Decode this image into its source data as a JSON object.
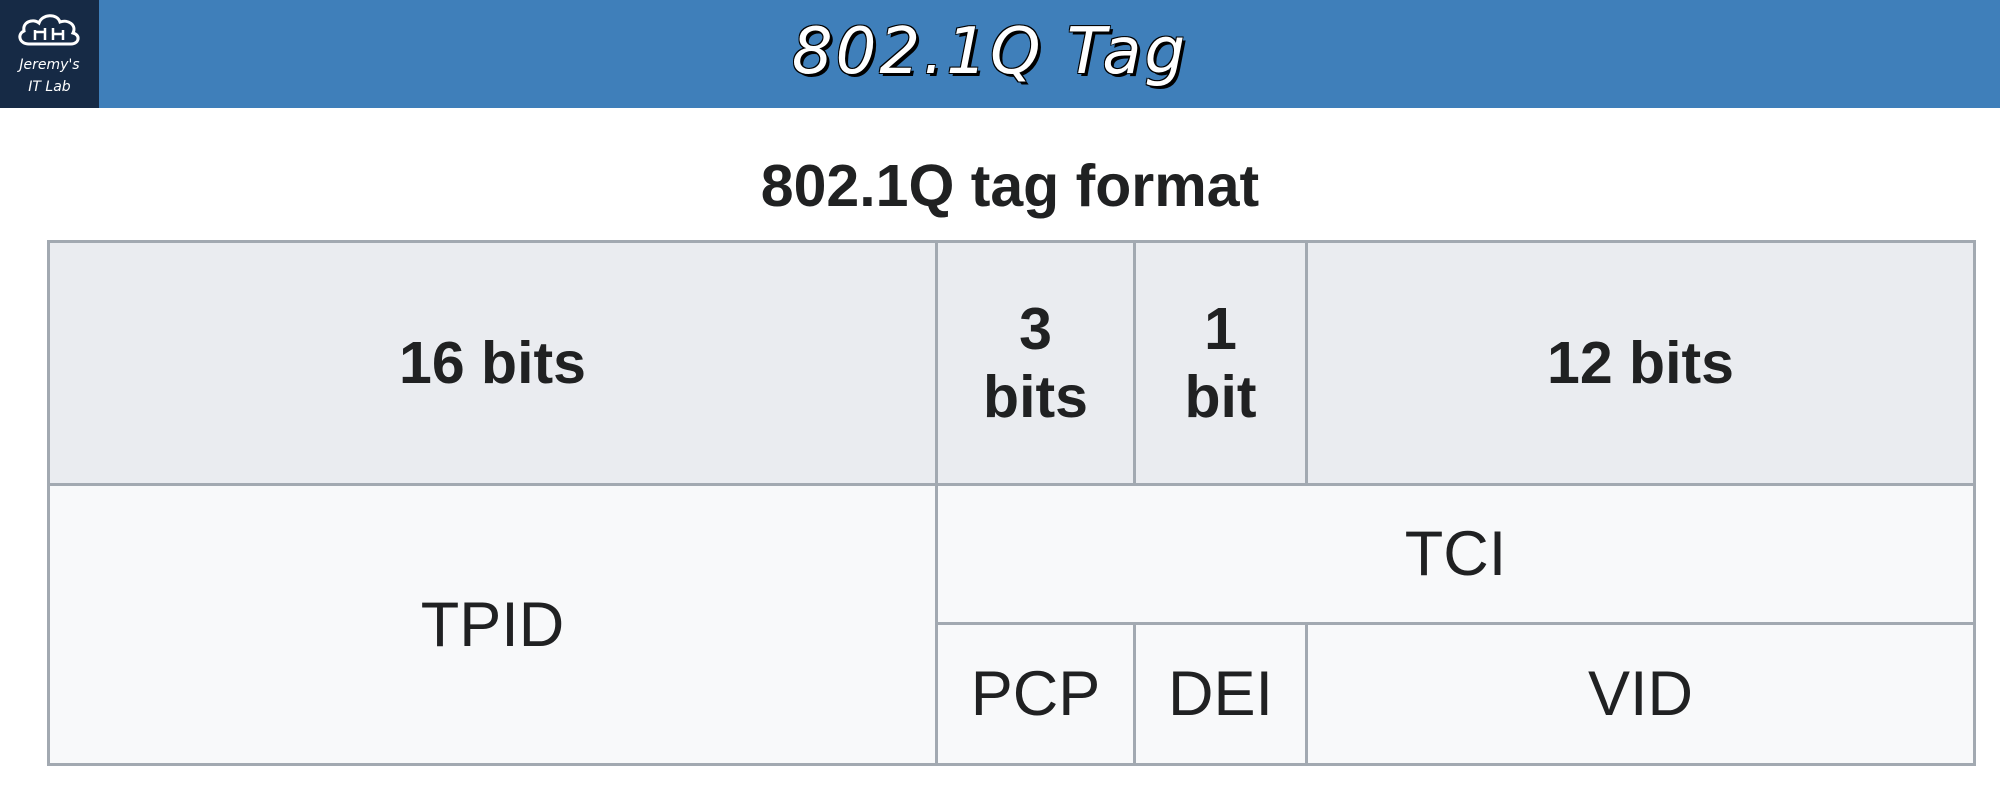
{
  "header": {
    "title": "802.1Q Tag",
    "logo_line1": "Jeremy's",
    "logo_line2": "IT Lab"
  },
  "caption": "802.1Q tag format",
  "table": {
    "bits_row": [
      "16 bits",
      "3\nbits",
      "1\nbit",
      "12 bits"
    ],
    "tpid": "TPID",
    "tci": "TCI",
    "fields": [
      "PCP",
      "DEI",
      "VID"
    ]
  },
  "colors": {
    "header_bg": "#3f7fba",
    "logo_bg": "#162a45",
    "header_cell_bg": "#eaecf0",
    "body_cell_bg": "#f8f9fa",
    "border": "#a2a9b1",
    "text": "#202122"
  }
}
